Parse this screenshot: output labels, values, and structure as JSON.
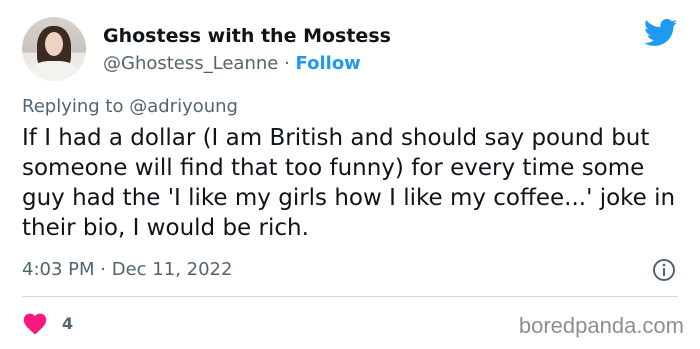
{
  "tweet": {
    "author": {
      "display_name": "Ghostess with the Mostess",
      "handle": "@Ghostess_Leanne",
      "separator": "·",
      "follow_label": "Follow"
    },
    "reply_to": {
      "prefix": "Replying to",
      "mention": "@adriyoung"
    },
    "text": "If I had a dollar (I am British and should say pound but someone will find that too funny) for every time some guy had the 'I like my girls how I like my coffee...' joke in their bio, I would be rich.",
    "time": "4:03 PM",
    "meta_separator": "·",
    "date": "Dec 11, 2022",
    "likes": "4"
  },
  "icons": {
    "brand": "twitter-bird-icon",
    "info": "info-icon",
    "like": "heart-icon"
  },
  "colors": {
    "accent": "#1d9bf0",
    "like": "#f91880",
    "secondary_text": "#536471",
    "primary_text": "#0f1419"
  },
  "watermark": "boredpanda.com"
}
